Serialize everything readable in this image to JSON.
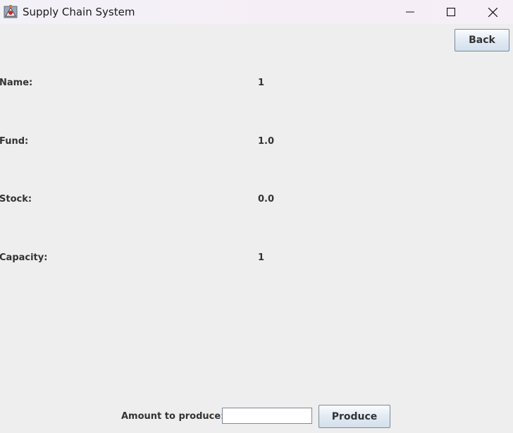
{
  "window": {
    "title": "Supply Chain System",
    "icon": "java-app-icon",
    "controls": [
      "minimize-icon",
      "maximize-icon",
      "close-icon"
    ]
  },
  "toolbar": {
    "back_label": "Back"
  },
  "fields": [
    {
      "label": "Name:",
      "value": "1"
    },
    {
      "label": "Fund:",
      "value": "1.0"
    },
    {
      "label": "Stock:",
      "value": "0.0"
    },
    {
      "label": "Capacity:",
      "value": "1"
    }
  ],
  "production": {
    "amount_label": "Amount to produce:",
    "amount_value": "",
    "produce_label": "Produce"
  },
  "colors": {
    "background": "#eeeeee",
    "titlebar": "#f5f0f7",
    "button_border": "#7a8a99",
    "text": "#333333"
  }
}
